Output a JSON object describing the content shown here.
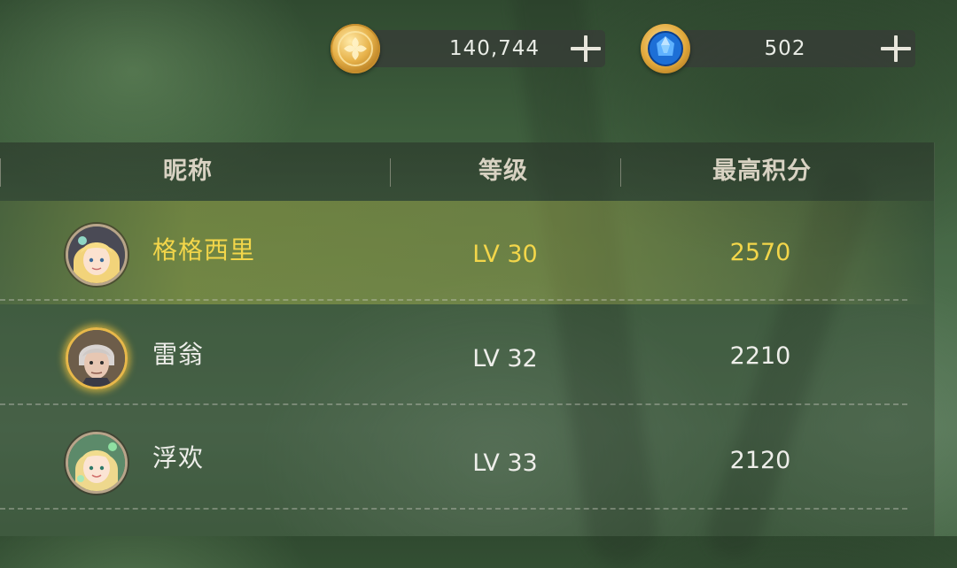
{
  "currencies": [
    {
      "icon": "gold-coin-icon",
      "value": "140,744",
      "add_label": "add-gold"
    },
    {
      "icon": "blue-gem-icon",
      "value": "502",
      "add_label": "add-gems"
    }
  ],
  "table": {
    "headers": [
      "昵称",
      "等级",
      "最高积分"
    ],
    "rows": [
      {
        "nickname": "格格西里",
        "level": "LV 30",
        "score": "2570",
        "highlighted": true
      },
      {
        "nickname": "雷翁",
        "level": "LV 32",
        "score": "2210",
        "highlighted": false
      },
      {
        "nickname": "浮欢",
        "level": "LV 33",
        "score": "2120",
        "highlighted": false
      }
    ]
  },
  "colors": {
    "highlight_text": "#f3d64a",
    "normal_text": "#eeeeea",
    "header_text": "#d8d2c2"
  }
}
